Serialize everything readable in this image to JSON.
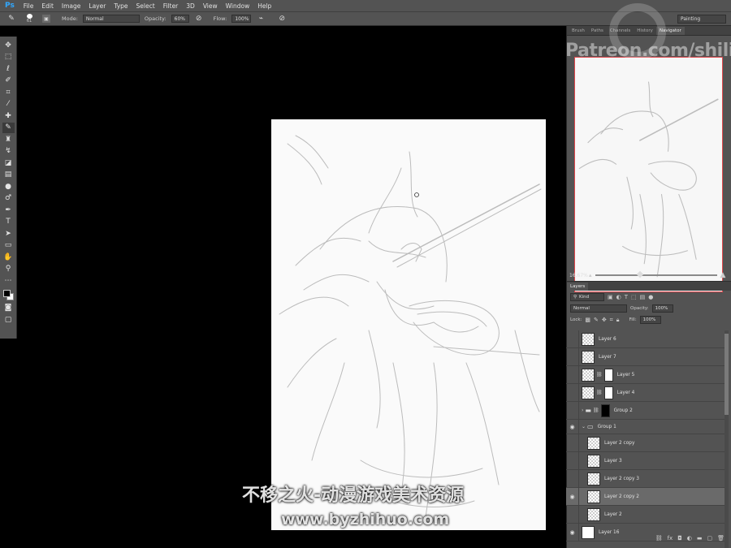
{
  "app_logo": "Ps",
  "menu": [
    "File",
    "Edit",
    "Image",
    "Layer",
    "Type",
    "Select",
    "Filter",
    "3D",
    "View",
    "Window",
    "Help"
  ],
  "options": {
    "brush_size": "61",
    "mode_label": "Mode:",
    "mode_value": "Normal",
    "opacity_label": "Opacity:",
    "opacity_value": "60%",
    "flow_label": "Flow:",
    "flow_value": "100%",
    "workspace": "Painting"
  },
  "panel_tabs": [
    "Brush",
    "Paths",
    "Channels",
    "History",
    "Navigator"
  ],
  "navigator": {
    "zoom": "16.67%",
    "slider_level": 0.35
  },
  "layers_panel": {
    "title": "Layers",
    "filter_kind": "Kind",
    "blend_mode": "Normal",
    "opacity_label": "Opacity:",
    "opacity_value": "100%",
    "lock_label": "Lock:",
    "fill_label": "Fill:",
    "fill_value": "100%",
    "layers": [
      {
        "name": "Layer 6",
        "visible": false,
        "type": "pixel"
      },
      {
        "name": "Layer 7",
        "visible": false,
        "type": "pixel"
      },
      {
        "name": "Layer 5",
        "visible": false,
        "type": "masked"
      },
      {
        "name": "Layer 4",
        "visible": false,
        "type": "masked"
      },
      {
        "name": "Group 2",
        "visible": false,
        "type": "group-mask"
      },
      {
        "name": "Group 1",
        "visible": true,
        "type": "group-open"
      },
      {
        "name": "Layer 2 copy",
        "visible": false,
        "type": "child"
      },
      {
        "name": "Layer 3",
        "visible": false,
        "type": "child"
      },
      {
        "name": "Layer 2 copy 3",
        "visible": false,
        "type": "child"
      },
      {
        "name": "Layer 2 copy 2",
        "visible": true,
        "type": "child",
        "selected": true
      },
      {
        "name": "Layer 2",
        "visible": false,
        "type": "child"
      },
      {
        "name": "Layer 16",
        "visible": true,
        "type": "white"
      }
    ]
  },
  "watermarks": {
    "patreon": "Patreon.com/shilin",
    "site_cn": "不移之火-动漫游戏美术资源",
    "site_url": "www.byzhihuo.com"
  },
  "icons": {
    "tools": [
      "move-icon",
      "marquee-icon",
      "lasso-icon",
      "quick-select-icon",
      "crop-icon",
      "eyedropper-icon",
      "healing-icon",
      "brush-icon",
      "stamp-icon",
      "history-brush-icon",
      "eraser-icon",
      "gradient-icon",
      "blur-icon",
      "dodge-icon",
      "pen-icon",
      "type-icon",
      "path-select-icon",
      "shape-icon",
      "hand-icon",
      "zoom-icon",
      "more-tools-icon"
    ]
  }
}
